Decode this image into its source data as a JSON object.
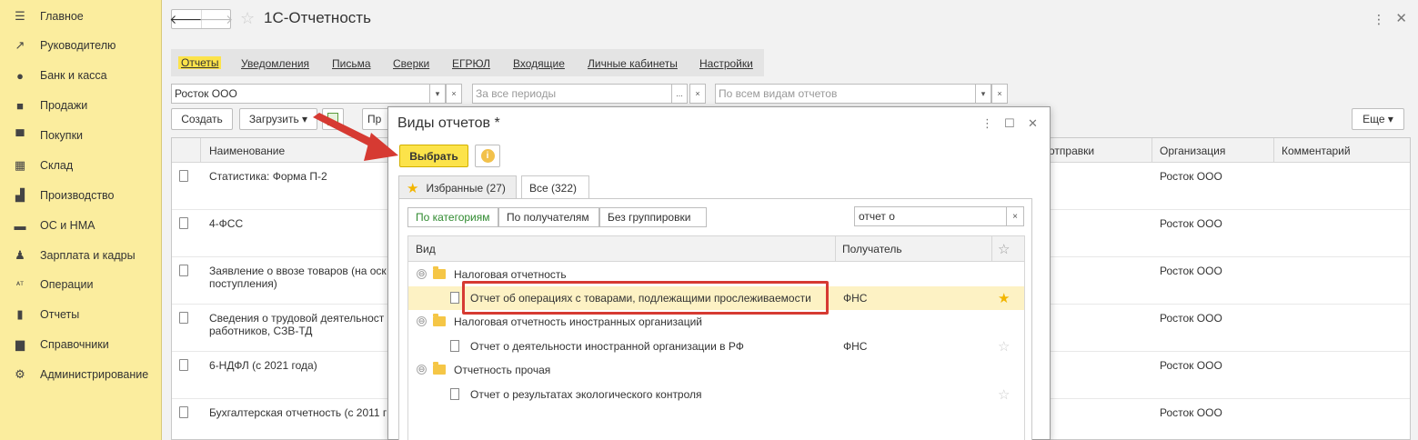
{
  "sidebar": {
    "items": [
      {
        "label": "Главное",
        "icon": "menu-icon"
      },
      {
        "label": "Руководителю",
        "icon": "trend-icon"
      },
      {
        "label": "Банк и касса",
        "icon": "coin-icon"
      },
      {
        "label": "Продажи",
        "icon": "bag-icon"
      },
      {
        "label": "Покупки",
        "icon": "cart-icon"
      },
      {
        "label": "Склад",
        "icon": "warehouse-icon"
      },
      {
        "label": "Производство",
        "icon": "factory-icon"
      },
      {
        "label": "ОС и НМА",
        "icon": "truck-icon"
      },
      {
        "label": "Зарплата и кадры",
        "icon": "person-icon"
      },
      {
        "label": "Операции",
        "icon": "operations-icon"
      },
      {
        "label": "Отчеты",
        "icon": "chart-icon"
      },
      {
        "label": "Справочники",
        "icon": "book-icon"
      },
      {
        "label": "Администрирование",
        "icon": "gear-icon"
      }
    ]
  },
  "header": {
    "back": "🡐",
    "forward": "🡒",
    "star": "☆",
    "title": "1С-Отчетность",
    "more": "⋮",
    "close": "✕"
  },
  "tabs": [
    "Отчеты",
    "Уведомления",
    "Письма",
    "Сверки",
    "ЕГРЮЛ",
    "Входящие",
    "Личные кабинеты",
    "Настройки"
  ],
  "filters": {
    "organization": "Росток ООО",
    "period_placeholder": "За все периоды",
    "kind_placeholder": "По всем видам отчетов",
    "dropdown": "▾",
    "clear": "×",
    "ellipsis": "..."
  },
  "toolbar": {
    "create": "Создать",
    "upload": "Загрузить ▾",
    "partial": "Пр",
    "more": "Еще ▾"
  },
  "grid": {
    "headers": {
      "name": "Наименование",
      "sending": "отправки",
      "org": "Организация",
      "comment": "Комментарий"
    },
    "rows": [
      {
        "name": "Статистика: Форма П-2",
        "org": "Росток ООО"
      },
      {
        "name": "4-ФСС",
        "org": "Росток ООО"
      },
      {
        "name": "Заявление о ввозе товаров (на оск\nпоступления)",
        "org": "Росток ООО"
      },
      {
        "name": "Сведения о трудовой деятельност\nработников, СЗВ-ТД",
        "org": "Росток ООО"
      },
      {
        "name": "6-НДФЛ (с 2021 года)",
        "org": "Росток ООО"
      },
      {
        "name": "Бухгалтерская отчетность (с 2011 г",
        "org": "Росток ООО"
      }
    ]
  },
  "modal": {
    "title": "Виды отчетов *",
    "more": "⋮",
    "maximize": "☐",
    "close": "✕",
    "select_button": "Выбрать",
    "info": "i",
    "tabs": {
      "favorites": "Избранные (27)",
      "all": "Все (322)",
      "star": "★"
    },
    "segments": [
      "По категориям",
      "По получателям",
      "Без группировки"
    ],
    "search_value": "отчет о",
    "search_clear": "×",
    "table_headers": {
      "kind": "Вид",
      "recipient": "Получатель",
      "fav": "☆"
    },
    "tree": [
      {
        "type": "group",
        "label": "Налоговая отчетность",
        "toggle": "⊖"
      },
      {
        "type": "item",
        "label": "Отчет об операциях с товарами, подлежащими прослеживаемости",
        "recipient": "ФНС",
        "star": "★",
        "favorite": true,
        "selected": true
      },
      {
        "type": "group",
        "label": "Налоговая отчетность иностранных организаций",
        "toggle": "⊖"
      },
      {
        "type": "item",
        "label": "Отчет о деятельности иностранной организации в РФ",
        "recipient": "ФНС",
        "star": "☆",
        "favorite": false,
        "selected": false
      },
      {
        "type": "group",
        "label": "Отчетность прочая",
        "toggle": "⊖"
      },
      {
        "type": "item",
        "label": "Отчет о результатах экологического контроля",
        "recipient": "",
        "star": "☆",
        "favorite": false,
        "selected": false
      }
    ]
  },
  "colors": {
    "sidebar_bg": "#fbed9e",
    "accent_yellow": "#fce34a",
    "annotation_red": "#d63a32",
    "favorite_star": "#f2b500"
  }
}
